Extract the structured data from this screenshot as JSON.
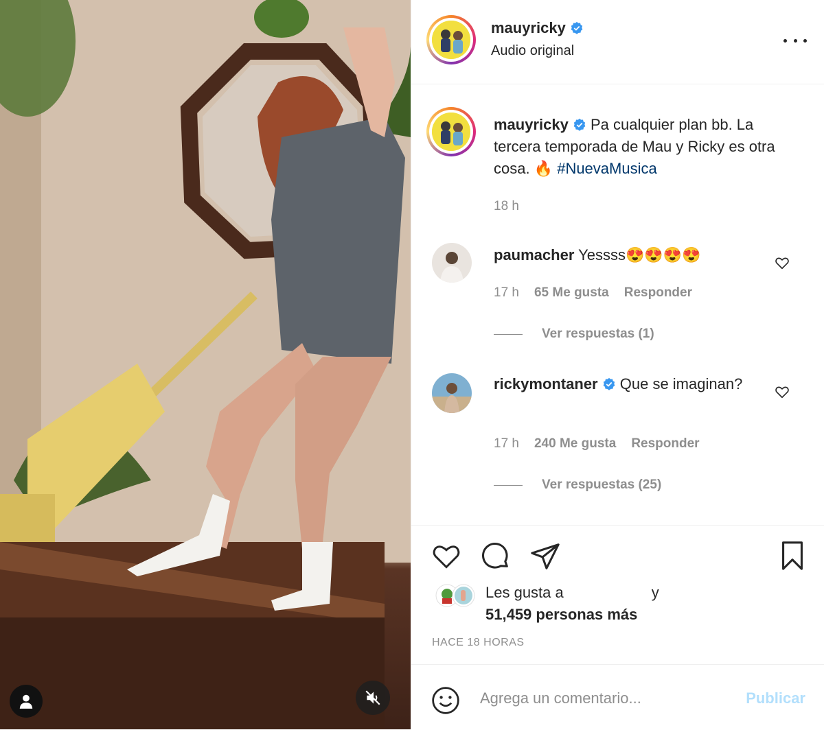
{
  "post": {
    "username": "mauyricky",
    "subtitle": "Audio original",
    "caption_username": "mauyricky",
    "caption_text": "Pa cualquier plan bb. La tercera temporada de Mau y Ricky es otra cosa. 🔥 ",
    "caption_hashtag": "#NuevaMusica",
    "caption_time": "18 h"
  },
  "comments": [
    {
      "username": "paumacher",
      "text": "Yessss😍😍😍😍",
      "time": "17 h",
      "likes": "65 Me gusta",
      "reply": "Responder",
      "view_replies": "Ver respuestas (1)"
    },
    {
      "username": "rickymontaner",
      "text": "Que se imaginan?",
      "time": "17 h",
      "likes": "240 Me gusta",
      "reply": "Responder",
      "view_replies": "Ver respuestas (25)"
    }
  ],
  "likes": {
    "prefix": "Les gusta a",
    "connector": "y",
    "count_text": "51,459 personas más"
  },
  "timestamp": "HACE 18 HORAS",
  "compose": {
    "placeholder": "Agrega un comentario...",
    "publish_label": "Publicar"
  },
  "icons": {
    "verified": "verified-badge-icon",
    "more": "more-options-icon",
    "like": "heart-icon",
    "comment": "comment-bubble-icon",
    "share": "paper-plane-icon",
    "save": "bookmark-icon",
    "emoji": "smiley-icon",
    "tag": "user-tag-icon",
    "mute": "speaker-muted-icon"
  },
  "colors": {
    "verified_blue": "#3897f0",
    "hashtag": "#00376b",
    "secondary_text": "#8e8e8e",
    "publish_disabled": "#b2dffc"
  }
}
